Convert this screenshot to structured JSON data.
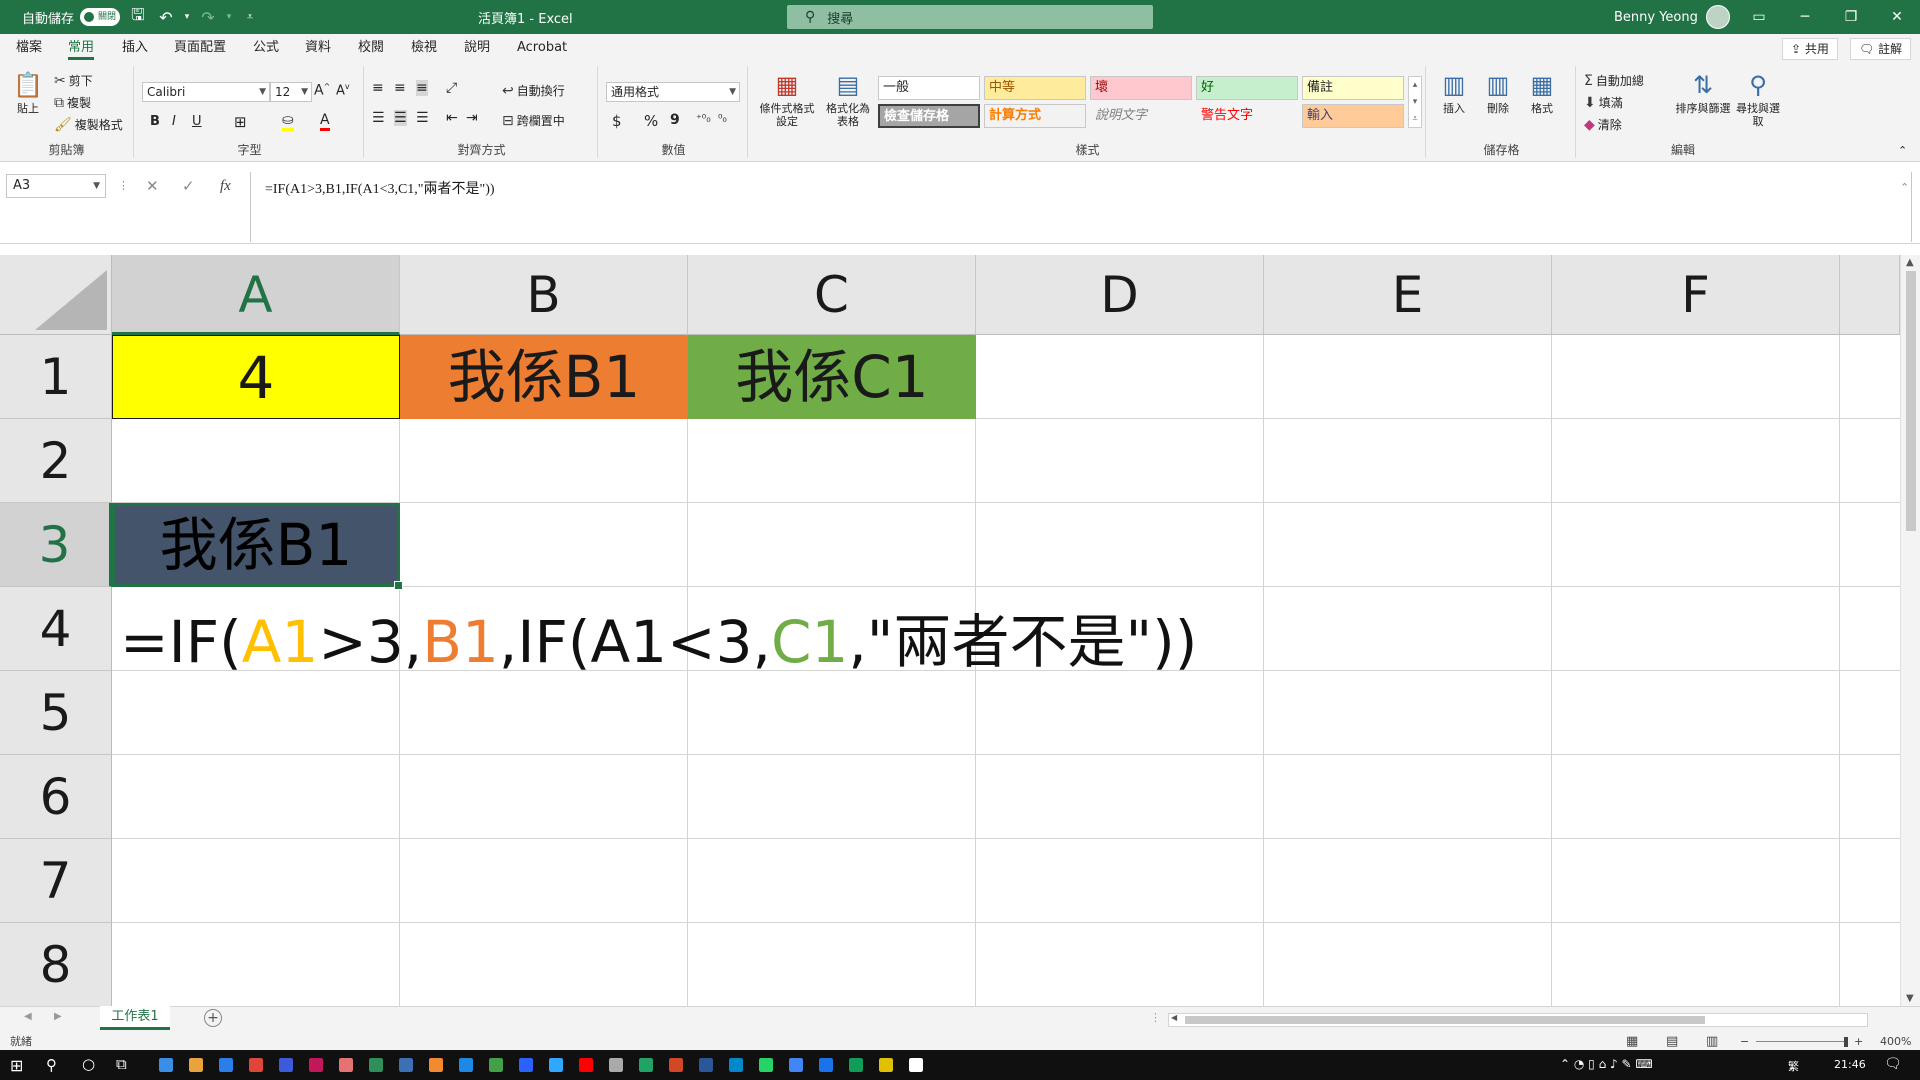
{
  "titlebar": {
    "autosave_label": "自動儲存",
    "autosave_state": "關閉",
    "title": "活頁簿1  -  Excel",
    "search_placeholder": "搜尋",
    "user_name": "Benny Yeong"
  },
  "ribbon_tabs": [
    "檔案",
    "常用",
    "插入",
    "頁面配置",
    "公式",
    "資料",
    "校閱",
    "檢視",
    "說明",
    "Acrobat"
  ],
  "ribbon_right": {
    "share": "共用",
    "comments": "註解"
  },
  "ribbon": {
    "clipboard": {
      "paste": "貼上",
      "cut": "剪下",
      "copy": "複製",
      "format_painter": "複製格式",
      "label": "剪貼簿"
    },
    "font": {
      "name": "Calibri",
      "size": "12",
      "bold": "B",
      "italic": "I",
      "underline": "U",
      "label": "字型"
    },
    "alignment": {
      "wrap": "自動換行",
      "merge": "跨欄置中",
      "label": "對齊方式"
    },
    "number": {
      "format": "通用格式",
      "currency": "$",
      "percent": "%",
      "comma": "9",
      "label": "數值"
    },
    "styles": {
      "conditional": "條件式格式設定",
      "as_table": "格式化為表格",
      "cells": [
        "一般",
        "中等",
        "壞",
        "好",
        "備註",
        "檢查儲存格",
        "計算方式",
        "說明文字",
        "警告文字",
        "輸入"
      ],
      "label": "樣式"
    },
    "cells": {
      "insert": "插入",
      "delete": "刪除",
      "format": "格式",
      "label": "儲存格"
    },
    "editing": {
      "autosum": "自動加總",
      "fill": "填滿",
      "clear": "清除",
      "sort": "排序與篩選",
      "find": "尋找與選取",
      "label": "編輯"
    }
  },
  "formula_bar": {
    "name_box": "A3",
    "formula": "=IF(A1>3,B1,IF(A1<3,C1,\"兩者不是\"))"
  },
  "grid": {
    "columns": [
      "A",
      "B",
      "C",
      "D",
      "E",
      "F"
    ],
    "rows": [
      "1",
      "2",
      "3",
      "4",
      "5",
      "6",
      "7",
      "8"
    ],
    "selected_column": "A",
    "selected_row": "3",
    "cells": {
      "A1": "4",
      "B1": "我係B1",
      "C1": "我係C1",
      "A3": "我係B1"
    },
    "a4_parts": [
      "=IF(",
      "A1",
      ">3,",
      "B1",
      ",IF(A1<3,",
      "C1",
      ",\"兩者不是\"))"
    ]
  },
  "colors": {
    "excel_green": "#217346",
    "a1_fill": "#ffff00",
    "b1_fill": "#ed7d31",
    "c1_fill": "#70ad47",
    "a3_fill": "#44546a",
    "ref_a1": "#ffc000",
    "ref_b1": "#ed7d31",
    "ref_c1": "#70ad47"
  },
  "sheet": {
    "tab": "工作表1",
    "add": "+"
  },
  "statusbar": {
    "ready": "就緒",
    "zoom": "400%"
  },
  "taskbar": {
    "ime": "繁",
    "time": "21:46"
  }
}
